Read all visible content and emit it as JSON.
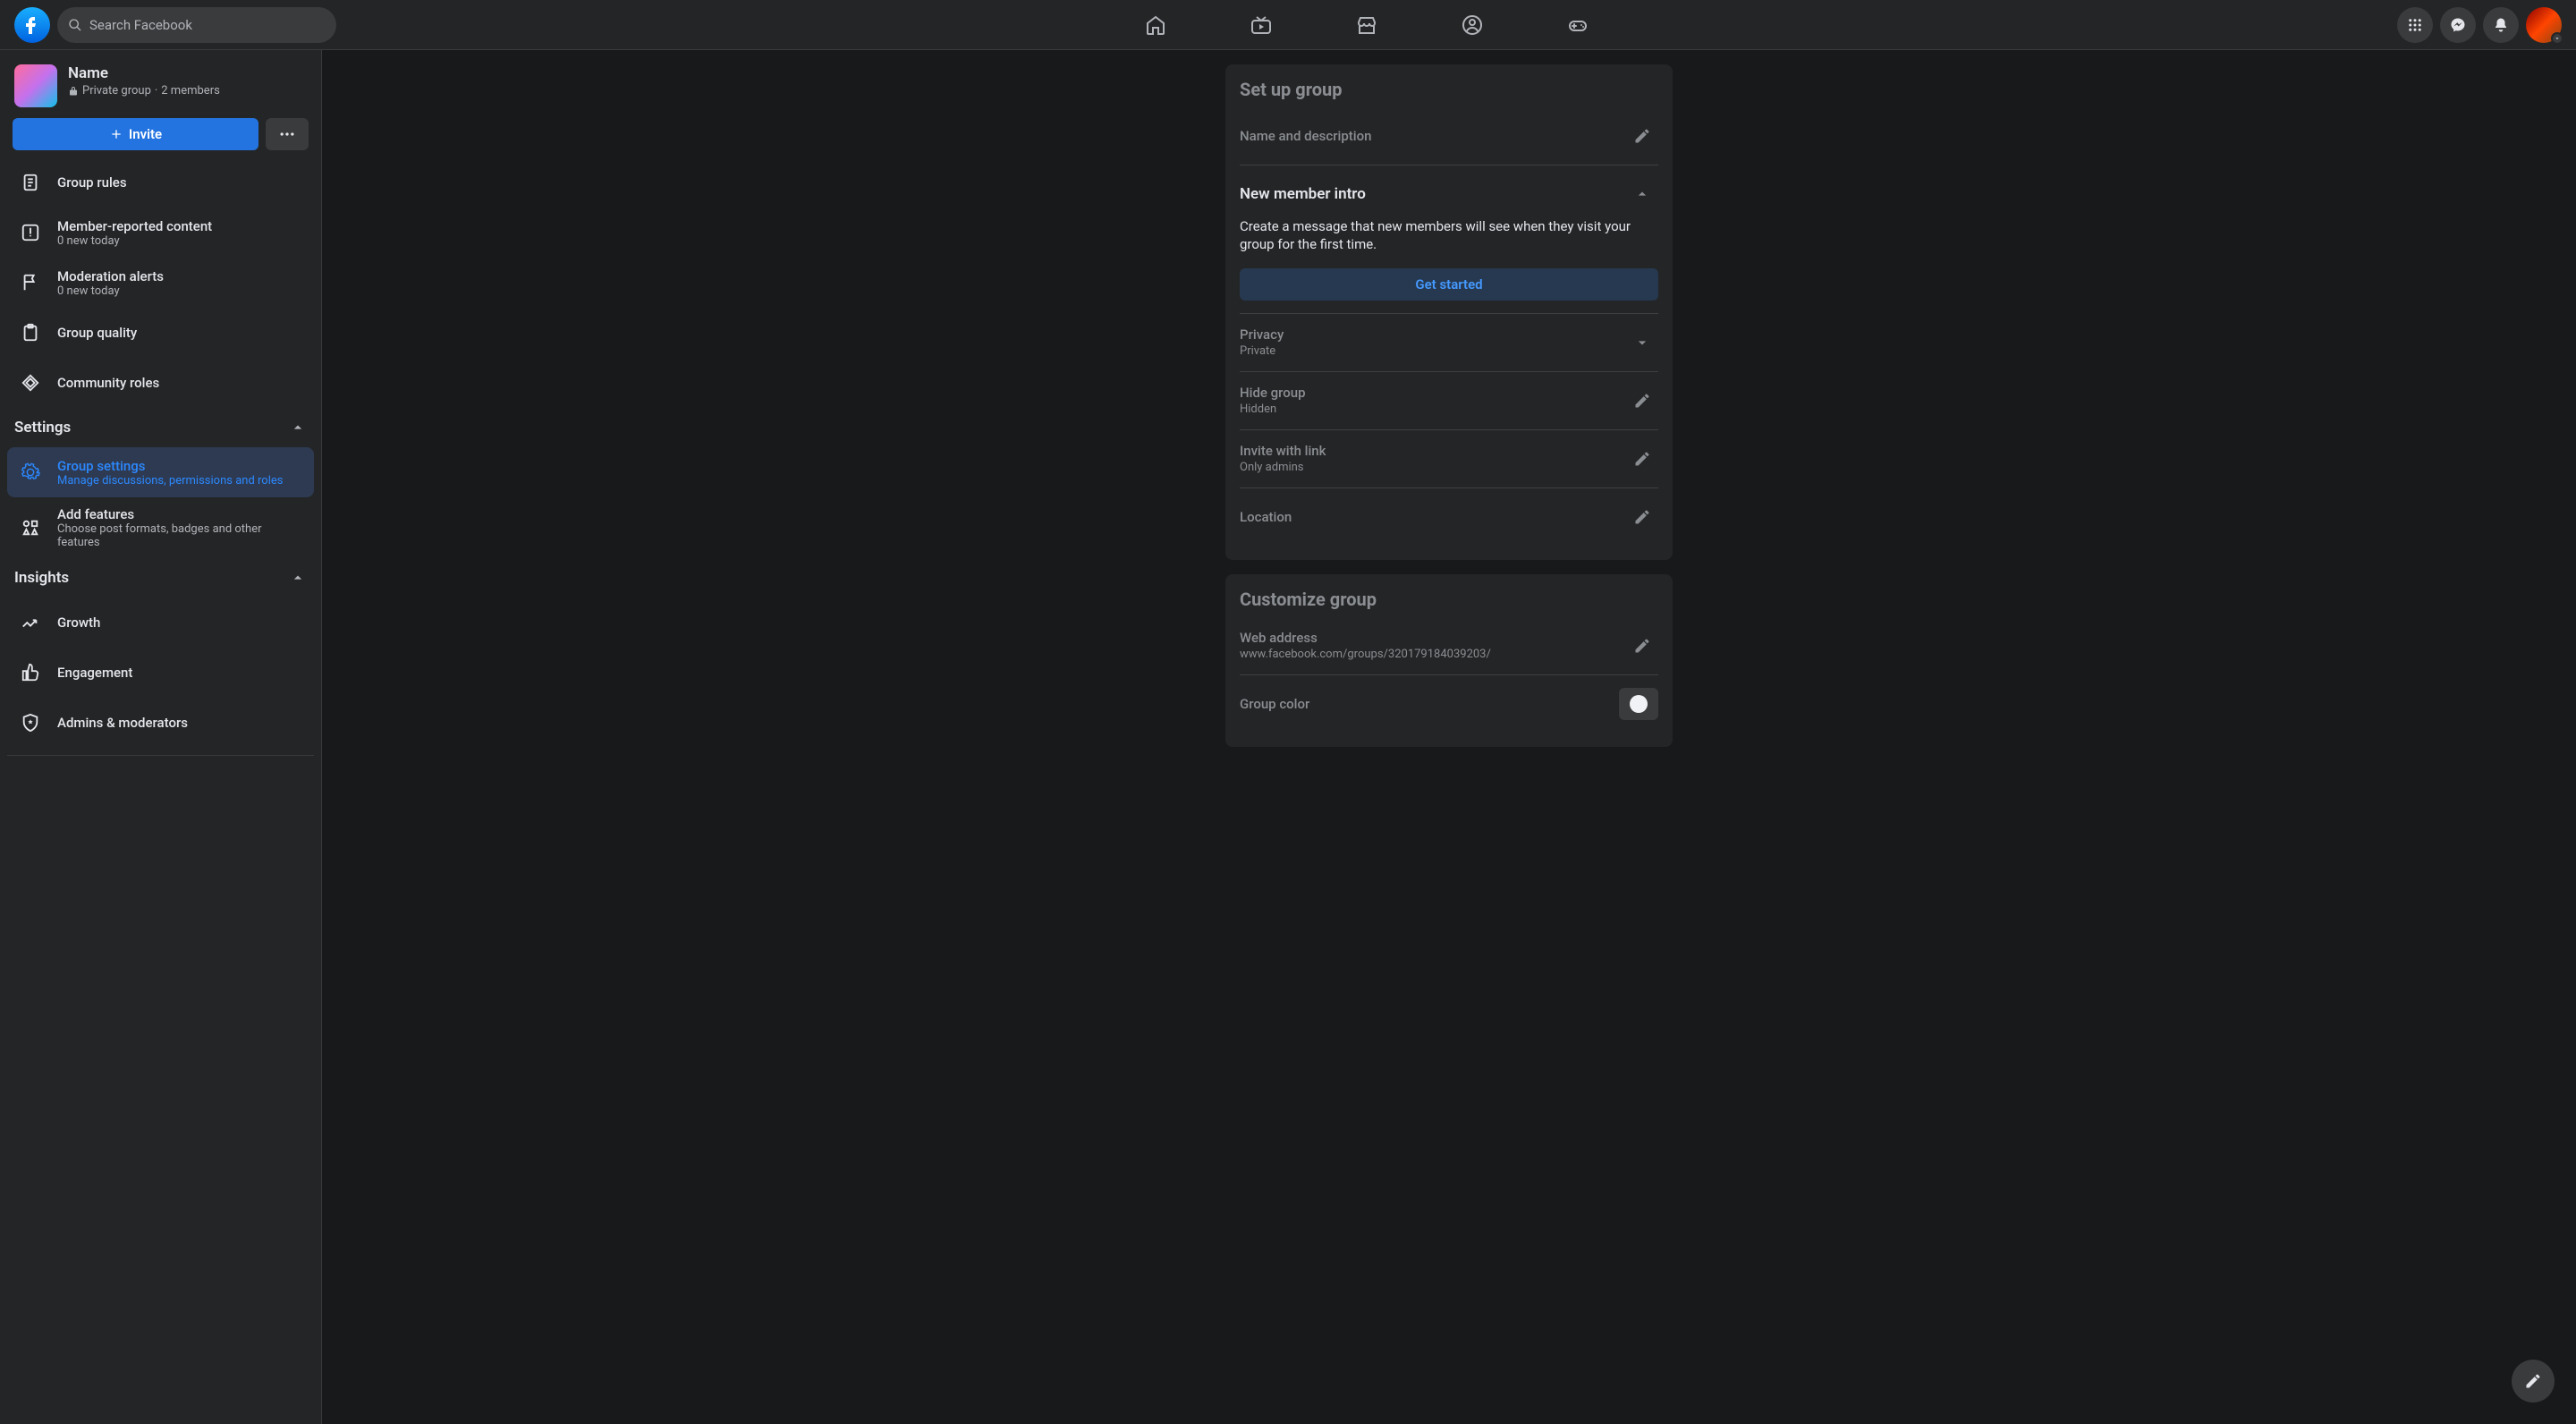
{
  "search": {
    "placeholder": "Search Facebook"
  },
  "group": {
    "name": "Name",
    "privacy": "Private group",
    "members": "2 members",
    "invite_label": "Invite"
  },
  "sidebar": {
    "items": [
      {
        "label": "Group rules"
      },
      {
        "label": "Member-reported content",
        "sub": "0 new today"
      },
      {
        "label": "Moderation alerts",
        "sub": "0 new today"
      },
      {
        "label": "Group quality"
      },
      {
        "label": "Community roles"
      }
    ],
    "settings_header": "Settings",
    "settings": [
      {
        "label": "Group settings",
        "sub": "Manage discussions, permissions and roles"
      },
      {
        "label": "Add features",
        "sub": "Choose post formats, badges and other features"
      }
    ],
    "insights_header": "Insights",
    "insights": [
      {
        "label": "Growth"
      },
      {
        "label": "Engagement"
      },
      {
        "label": "Admins & moderators"
      }
    ]
  },
  "setup": {
    "title": "Set up group",
    "name_desc": {
      "label": "Name and description"
    },
    "new_member": {
      "label": "New member intro",
      "desc": "Create a message that new members will see when they visit your group for the first time.",
      "cta": "Get started"
    },
    "privacy": {
      "label": "Privacy",
      "value": "Private"
    },
    "hide_group": {
      "label": "Hide group",
      "value": "Hidden"
    },
    "invite_link": {
      "label": "Invite with link",
      "value": "Only admins"
    },
    "location": {
      "label": "Location"
    }
  },
  "customize": {
    "title": "Customize group",
    "web": {
      "label": "Web address",
      "value": "www.facebook.com/groups/320179184039203/"
    },
    "color": {
      "label": "Group color"
    }
  }
}
